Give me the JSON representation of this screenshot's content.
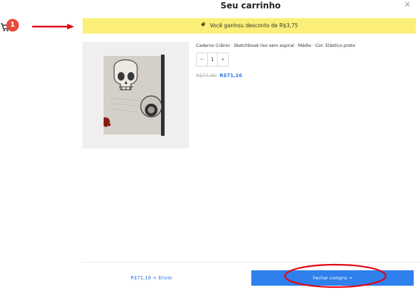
{
  "app": {
    "cart_count": "1",
    "colors": {
      "accent": "#2f80ed",
      "price": "#2d7be5",
      "banner": "#fbef78",
      "badge": "#e84a3b",
      "annotation": "#e30613"
    }
  },
  "header": {
    "title": "Seu carrinho",
    "close_label": "×"
  },
  "banner": {
    "icon": "tag-icon",
    "text": "Você ganhou desconto de R$3,75"
  },
  "item": {
    "name": "Caderno Crânio · Sketchbook liso sem espiral · Médio · Cor: Elástico preto",
    "quantity": "1",
    "minus_label": "−",
    "plus_label": "+",
    "old_price": "R$74,90",
    "new_price": "R$71,16",
    "image_icon": "notebook-product-image"
  },
  "footer": {
    "total": "R$71,16 + Envio",
    "checkout_label": "Fechar compra →"
  }
}
